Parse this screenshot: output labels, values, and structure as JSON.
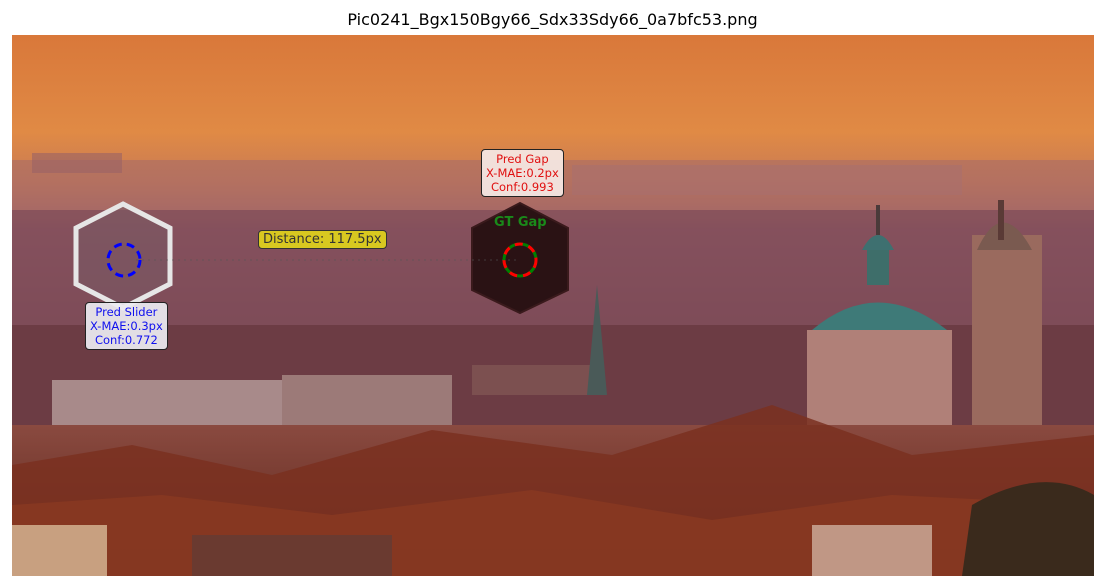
{
  "title": "Pic0241_Bgx150Bgy66_Sdx33Sdy66_0a7bfc53.png",
  "pred_slider": {
    "name": "Pred Slider",
    "xmae": "X-MAE:0.3px",
    "conf": "Conf:0.772"
  },
  "pred_gap": {
    "name": "Pred Gap",
    "xmae": "X-MAE:0.2px",
    "conf": "Conf:0.993"
  },
  "gt_gap": "GT Gap",
  "distance": "Distance: 117.5px",
  "colors": {
    "pred_slider": "#0000ff",
    "pred_gap": "#ff0000",
    "gt_gap": "#008000",
    "distance_box": "#d8c820"
  }
}
